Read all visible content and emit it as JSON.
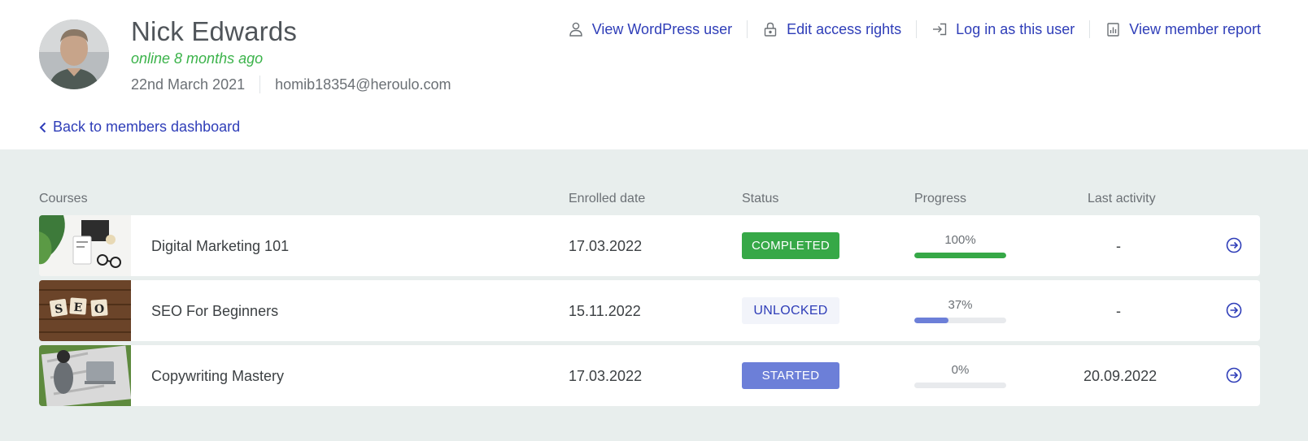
{
  "user": {
    "name": "Nick Edwards",
    "online": "online 8 months ago",
    "joined": "22nd March 2021",
    "email": "homib18354@heroulo.com"
  },
  "actions": [
    {
      "label": "View WordPress user",
      "icon": "user-icon"
    },
    {
      "label": "Edit access rights",
      "icon": "lock-icon"
    },
    {
      "label": "Log in as this user",
      "icon": "login-icon"
    },
    {
      "label": "View member report",
      "icon": "report-icon"
    }
  ],
  "back_link": "Back to members dashboard",
  "columns": {
    "courses": "Courses",
    "enrolled": "Enrolled date",
    "status": "Status",
    "progress": "Progress",
    "last_activity": "Last activity"
  },
  "courses": [
    {
      "name": "Digital Marketing 101",
      "enrolled": "17.03.2022",
      "status": "COMPLETED",
      "progress_label": "100%",
      "progress": 1.0,
      "last_activity": "-",
      "progress_color": "#36a847"
    },
    {
      "name": "SEO For Beginners",
      "enrolled": "15.11.2022",
      "status": "UNLOCKED",
      "progress_label": "37%",
      "progress": 0.37,
      "last_activity": "-",
      "progress_color": "#6c7fd8"
    },
    {
      "name": "Copywriting Mastery",
      "enrolled": "17.03.2022",
      "status": "STARTED",
      "progress_label": "0%",
      "progress": 0.0,
      "last_activity": "20.09.2022",
      "progress_color": "#6c7fd8"
    }
  ],
  "colors": {
    "link": "#2e3db8",
    "online": "#3bb34a",
    "completed": "#36a847",
    "started": "#6c7fd8",
    "background": "#e8eeed"
  }
}
